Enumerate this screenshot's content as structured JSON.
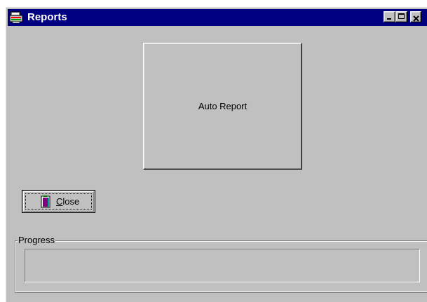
{
  "window": {
    "title": "Reports",
    "title_icon": "reports-app-icon",
    "controls": {
      "minimize_icon": "minimize-icon",
      "maximize_icon": "maximize-icon",
      "close_icon": "close-icon"
    }
  },
  "main": {
    "auto_report_label": "Auto Report",
    "close_button": {
      "accesskey": "C",
      "label_rest": "lose",
      "icon": "exit-door-icon"
    }
  },
  "progress": {
    "group_label": "Progress",
    "value": 0
  },
  "colors": {
    "titlebar": "#000080",
    "window_face": "#c0c0c0"
  }
}
